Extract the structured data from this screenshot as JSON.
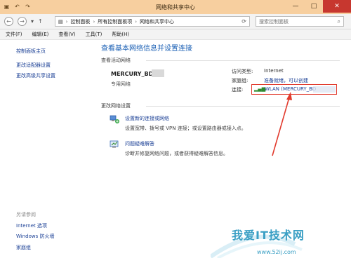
{
  "window": {
    "title": "网络和共享中心",
    "minimize": "—",
    "maximize": "□",
    "close": "✕"
  },
  "address": {
    "crumbs": [
      "控制面板",
      "所有控制面板项",
      "网络和共享中心"
    ],
    "search_placeholder": "搜索控制面板"
  },
  "menu": [
    "文件(F)",
    "编辑(E)",
    "查看(V)",
    "工具(T)",
    "帮助(H)"
  ],
  "left_pane": {
    "home": "控制面板主页",
    "links": [
      "更改适配器设置",
      "更改高级共享设置"
    ],
    "see_also_label": "另请参阅",
    "see_also": [
      "Internet 选项",
      "Windows 防火墙",
      "家庭组"
    ]
  },
  "main": {
    "heading": "查看基本网络信息并设置连接",
    "active_label": "查看活动网络",
    "network_name": "MERCURY_BD",
    "network_type": "专用网络",
    "access_type_label": "访问类型:",
    "access_type_value": "Internet",
    "homegroup_label": "家庭组:",
    "homegroup_value": "准备就绪，可以创建",
    "connections_label": "连接:",
    "connection_value": "WLAN (MERCURY_BD",
    "change_label": "更改网络设置",
    "tasks": [
      {
        "title": "设置新的连接或网络",
        "desc": "设置宽带、拨号或 VPN 连接；或设置路由器或接入点。"
      },
      {
        "title": "问题疑难解答",
        "desc": "诊断并修复网络问题，或者获得疑难解答信息。"
      }
    ]
  },
  "watermark": {
    "text": "我爱IT技术网",
    "url": "www.52ij.com"
  },
  "colors": {
    "titlebar": "#f7cf9f",
    "link": "#1a3f95",
    "heading": "#1a5fb4",
    "highlight": "#e23b2e"
  }
}
